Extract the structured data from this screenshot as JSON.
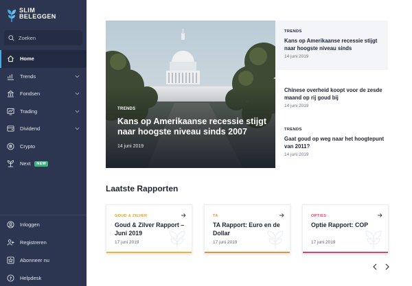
{
  "brand": {
    "line1": "SLIM",
    "line2": "BELEGGEN"
  },
  "search": {
    "placeholder": "Zoeken"
  },
  "nav": {
    "items": [
      {
        "label": "Home",
        "icon": "home-icon",
        "active": true
      },
      {
        "label": "Trends",
        "icon": "trends-icon",
        "expandable": true
      },
      {
        "label": "Fondsen",
        "icon": "funds-icon",
        "expandable": true
      },
      {
        "label": "Trading",
        "icon": "trading-icon",
        "expandable": true
      },
      {
        "label": "Dividend",
        "icon": "dividend-icon",
        "expandable": true
      },
      {
        "label": "Crypto",
        "icon": "bitcoin-icon"
      },
      {
        "label": "Next",
        "icon": "plant-icon",
        "badge": "NEW"
      }
    ],
    "bottom": [
      {
        "label": "Inloggen",
        "icon": "user-icon"
      },
      {
        "label": "Registreren",
        "icon": "register-icon"
      },
      {
        "label": "Abonneer nu",
        "icon": "star-icon"
      },
      {
        "label": "Helpdesk",
        "icon": "help-icon"
      }
    ]
  },
  "hero": {
    "kicker": "TRENDS",
    "title": "Kans op Amerikaanse recessie stijgt naar hoogste niveau sinds 2007",
    "date": "14 juni 2019"
  },
  "side_articles": [
    {
      "kicker": "TRENDS",
      "title": "Kans op Amerikaanse recessie stijgt naar hoogste niveau sinds",
      "date": "14 juni 2019"
    },
    {
      "kicker": "",
      "title": "Chinese overheid koopt voor de zesde maand op rij goud bij",
      "date": "14 juni 2019"
    },
    {
      "kicker": "TRENDS",
      "title": "Gaat goud op weg naar het hoogtepunt van 2011?",
      "date": "14 juni 2019"
    }
  ],
  "reports": {
    "title": "Laatste Rapporten",
    "items": [
      {
        "category": "GOUD & ZILVER",
        "title": "Goud & Zilver Rapport – Juni 2019",
        "date": "17 juni 2019",
        "color": "#f0b429"
      },
      {
        "category": "TA",
        "title": "TA Rapport: Euro en de Dollar",
        "date": "17 juni 2019",
        "color": "#e8913a"
      },
      {
        "category": "OPTIES",
        "title": "Optie Rapport: COP",
        "date": "17 juni 2019",
        "color": "#e0436b"
      }
    ]
  },
  "colors": {
    "sidebar": "#2c3650",
    "accent": "#4aa8e0",
    "badge": "#3fb27f"
  }
}
